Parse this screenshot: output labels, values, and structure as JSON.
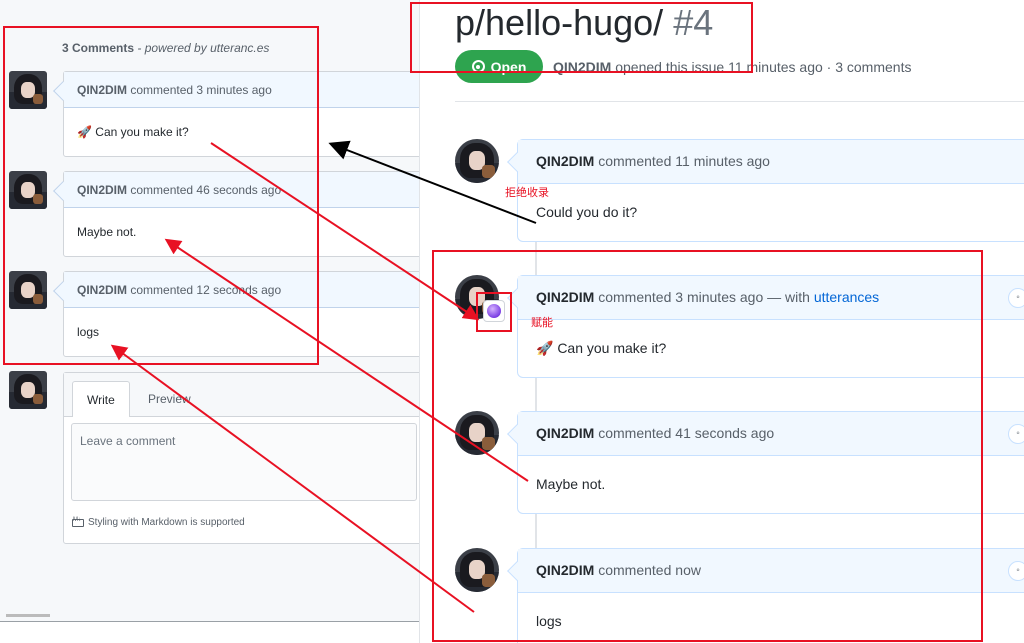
{
  "left": {
    "count_text": "3 Comments",
    "powered_text": " - powered by utteranc.es",
    "comments": [
      {
        "author": "QIN2DIM",
        "action": " commented ",
        "time": "3 minutes ago",
        "body": "🚀 Can you make it?"
      },
      {
        "author": "QIN2DIM",
        "action": " commented ",
        "time": "46 seconds ago",
        "body": "Maybe not."
      },
      {
        "author": "QIN2DIM",
        "action": " commented ",
        "time": "12 seconds ago",
        "body": "logs"
      }
    ],
    "editor": {
      "tab_write": "Write",
      "tab_preview": "Preview",
      "placeholder": "Leave a comment",
      "markdown_note": "Styling with Markdown is supported"
    }
  },
  "right": {
    "title_path": "p/hello-hugo/",
    "title_number": "#4",
    "status_label": "Open",
    "meta_author": "QIN2DIM",
    "meta_text": " opened this issue 11 minutes ago · 3 comments",
    "comments": [
      {
        "author": "QIN2DIM",
        "action": " commented ",
        "time": "11 minutes ago",
        "body": "Could you do it?",
        "with_prefix": "",
        "with_link": ""
      },
      {
        "author": "QIN2DIM",
        "action": " commented ",
        "time": "3 minutes ago",
        "with_prefix": " — with ",
        "with_link": "utterances",
        "body": "🚀 Can you make it?"
      },
      {
        "author": "QIN2DIM",
        "action": " commented ",
        "time": "41 seconds ago",
        "body": "Maybe not.",
        "with_prefix": "",
        "with_link": ""
      },
      {
        "author": "QIN2DIM",
        "action": " commented ",
        "time": "now",
        "body": "logs",
        "with_prefix": "",
        "with_link": ""
      }
    ]
  },
  "annotations": {
    "rejected": "拒绝收录",
    "empowered": "赋能"
  },
  "colors": {
    "annotation_red": "#e81123",
    "open_green": "#2ea44f",
    "link_blue": "#0366d6"
  }
}
